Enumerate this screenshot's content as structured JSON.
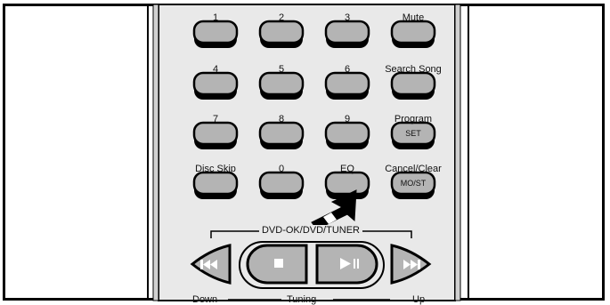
{
  "keypad": {
    "rows": [
      {
        "labels": [
          "1",
          "2",
          "3",
          "Mute"
        ],
        "buttons": [
          "",
          "",
          "",
          ""
        ]
      },
      {
        "labels": [
          "4",
          "5",
          "6",
          "Search Song"
        ],
        "buttons": [
          "",
          "",
          "",
          ""
        ]
      },
      {
        "labels": [
          "7",
          "8",
          "9",
          "Program"
        ],
        "buttons": [
          "",
          "",
          "",
          "SET"
        ]
      },
      {
        "labels": [
          "Disc Skip",
          "0",
          "EQ",
          "Cancel/Clear"
        ],
        "buttons": [
          "",
          "",
          "",
          "MO/ST"
        ]
      }
    ]
  },
  "transport": {
    "mode_label": "DVD-OK/DVD/TUNER",
    "down_label": "Down",
    "tuning_label": "Tuning",
    "up_label": "Up",
    "icons": [
      "skip-back",
      "stop",
      "play-pause",
      "skip-forward"
    ]
  },
  "colors": {
    "remote_body": "#e9e9e9",
    "button_fill": "#b4b4b4",
    "outline": "#000000"
  }
}
